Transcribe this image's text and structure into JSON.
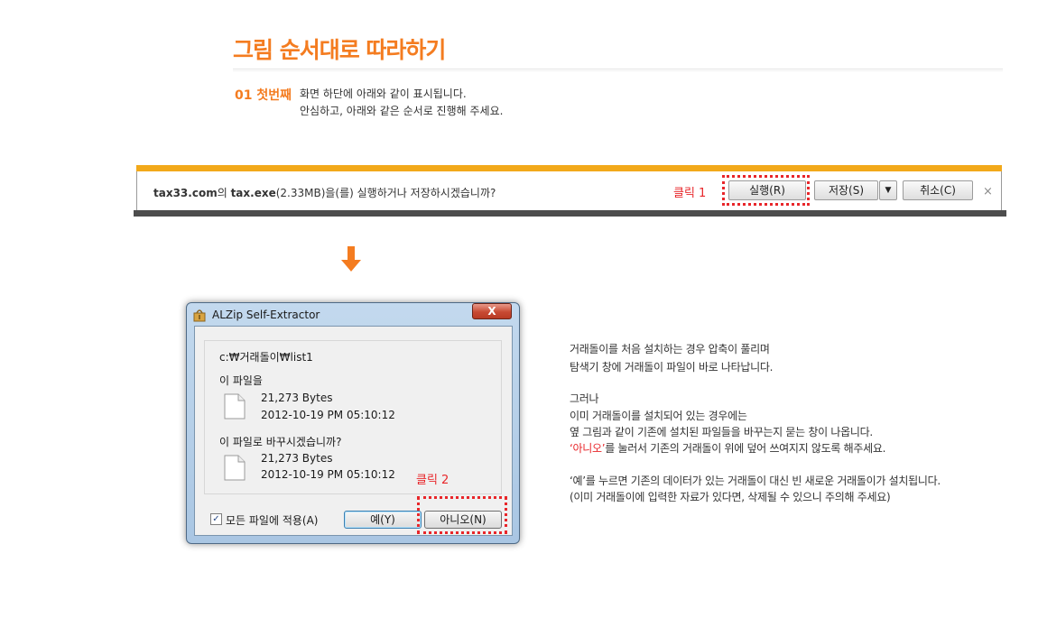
{
  "title": "그림 순서대로 따라하기",
  "step": {
    "number": "01 첫번째",
    "line1": "화면 하단에 아래와 같이 표시됩니다.",
    "line2": "안심하고, 아래와 같은 순서로 진행해 주세요."
  },
  "download_bar": {
    "site": "tax33.com",
    "msg_part1": "의 ",
    "file": "tax.exe",
    "msg_part2": "(2.33MB)을(를) 실행하거나 저장하시겠습니까?",
    "click_label": "클릭 1",
    "run_label": "실행(R)",
    "save_label": "저장(S)",
    "save_dropdown": "▼",
    "cancel_label": "취소(C)",
    "close_label": "×",
    "accent_color": "#f2a91a"
  },
  "dialog": {
    "title": "ALZip Self-Extractor",
    "close_label": "X",
    "path": "c:₩거래돌이₩list1",
    "this_file_label": "이 파일을",
    "file1_size": "21,273 Bytes",
    "file1_date": "2012-10-19 PM 05:10:12",
    "replace_question": "이 파일로 바꾸시겠습니까?",
    "file2_size": "21,273 Bytes",
    "file2_date": "2012-10-19 PM 05:10:12",
    "click_label": "클릭 2",
    "checkbox_label": "모든 파일에 적용(A)",
    "checkbox_checked": true,
    "yes_label": "예(Y)",
    "no_label": "아니오(N)"
  },
  "explanation": {
    "p1_l1": "거래돌이를 처음 설치하는 경우 압축이 풀리며",
    "p1_l2": "탐색기 창에 거래돌이 파일이 바로 나타납니다.",
    "p2_l1": "그러나",
    "p2_l2": "이미 거래돌이를 설치되어 있는 경우에는",
    "p2_l3": "옆 그림과 같이 기존에 설치된 파일들을 바꾸는지 묻는 창이 나옵니다.",
    "p2_l4_red": "‘아니오’",
    "p2_l4_rest": "를 눌러서 기존의 거래돌이 위에 덮어 쓰여지지 않도록 해주세요.",
    "p3_l1": "‘예’를 누르면 기존의 데이터가 있는 거래돌이 대신 빈 새로운 거래돌이가 설치됩니다.",
    "p3_l2": "(이미 거래돌이에 입력한 자료가 있다면, 삭제될 수 있으니 주의해 주세요)"
  },
  "colors": {
    "accent_orange": "#f47c20",
    "highlight_red": "#e8262a"
  }
}
